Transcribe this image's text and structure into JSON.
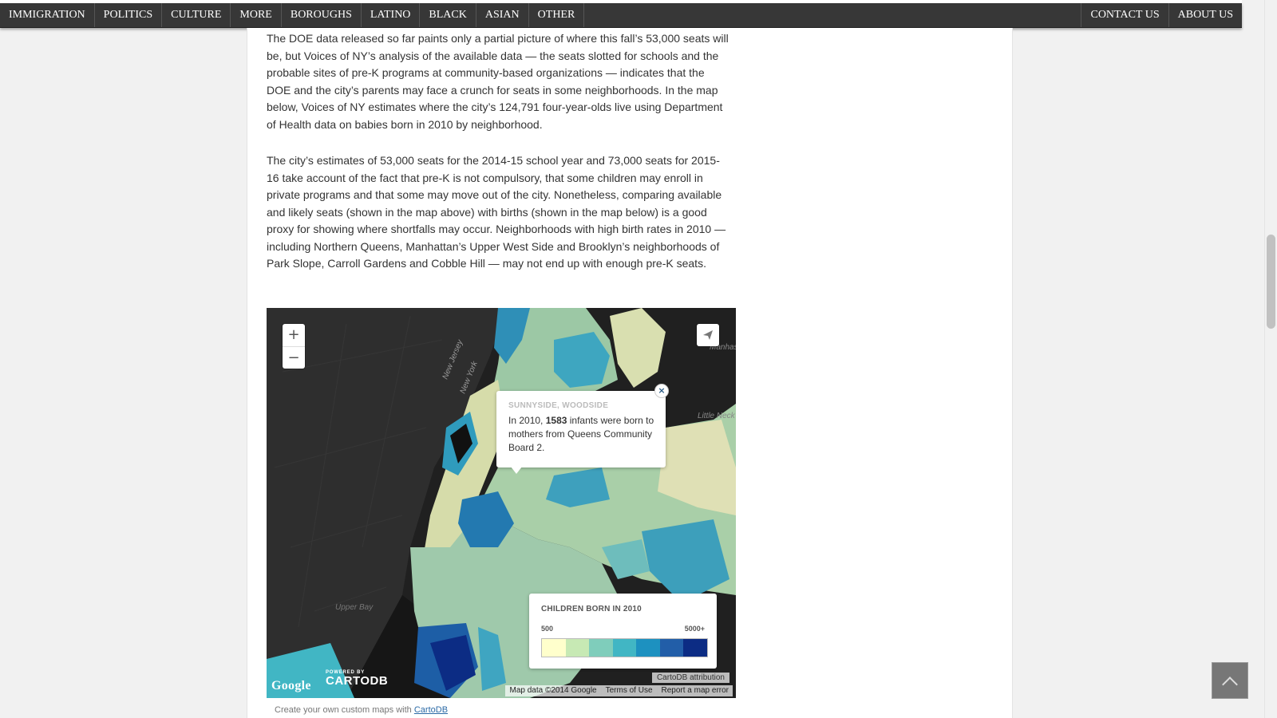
{
  "nav": {
    "left": [
      "IMMIGRATION",
      "POLITICS",
      "CULTURE",
      "MORE",
      "BOROUGHS",
      "LATINO",
      "BLACK",
      "ASIAN",
      "OTHER"
    ],
    "right": [
      "CONTACT US",
      "ABOUT US"
    ]
  },
  "article": {
    "para1": "The DOE data released so far paints only a partial picture of where this fall’s 53,000 seats will be, but Voices of NY’s analysis of the available data — the seats slotted for schools and the probable sites of pre-K programs at community-based organizations — indicates that the DOE and the city’s parents may face a crunch for seats in some neighborhoods. In the map below, Voices of NY estimates where the city’s 124,791 four-year-olds live using Department of Health data on babies born in 2010 by neighborhood.",
    "para2": "The city’s estimates of 53,000 seats for the 2014-15 school year and 73,000 seats for 2015-16 take account of the fact that pre-K is not compulsory, that some children may enroll in private programs and that some may move out of the city. Nonetheless, comparing available and likely seats (shown in the map above) with births (shown in the map below) is a good proxy for showing where shortfalls may occur. Neighborhoods with high birth rates in 2010 — including Northern Queens, Manhattan’s Upper West Side and Brooklyn’s neighborhoods of Park Slope, Carroll Gardens and Cobble Hill — may not end up with enough pre-K seats."
  },
  "map": {
    "zoom_in": "+",
    "zoom_out": "−",
    "share_icon": "paper-plane-icon",
    "labels": {
      "new_jersey": "New Jersey",
      "new_york": "New York",
      "upper_bay": "Upper Bay",
      "little_neck_bay": "Little Neck Bay",
      "manhasset_bay": "Manhasset Bay"
    },
    "popup": {
      "title": "SUNNYSIDE, WOODSIDE",
      "text_before": "In 2010, ",
      "count": "1583",
      "text_after": " infants were born to mothers from Queens Community Board 2.",
      "close": "×"
    },
    "legend": {
      "title": "CHILDREN BORN IN 2010",
      "min": "500",
      "max": "5000+",
      "colors": [
        "#ffffcc",
        "#c7e9b4",
        "#7fcdbb",
        "#41b6c4",
        "#1d91c0",
        "#225ea8",
        "#0c2c84"
      ]
    },
    "google": "Google",
    "cartodb_powered": "POWERED BY",
    "cartodb": "CARTODB",
    "attribution": "CartoDB attribution",
    "mapdata": [
      "Map data ©2014 Google",
      "Terms of Use",
      "Report a map error"
    ]
  },
  "caption": {
    "prefix": "Create your own custom maps with ",
    "link": "CartoDB"
  },
  "colors": {
    "nav_bg": "#373737",
    "map_bg": "#202020",
    "link": "#2b6aa6"
  }
}
